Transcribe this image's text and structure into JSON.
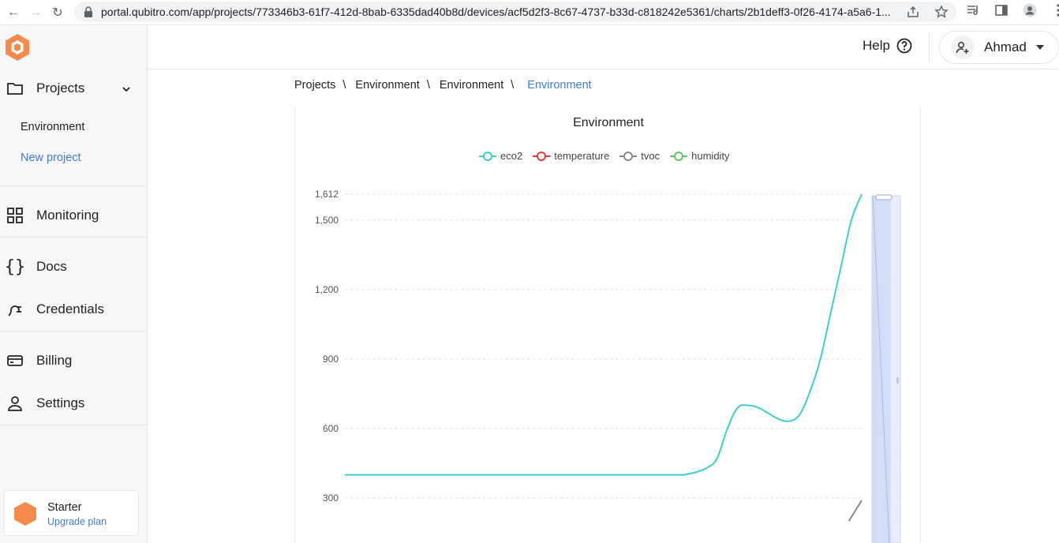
{
  "browser": {
    "url": "portal.qubitro.com/app/projects/773346b3-61f7-412d-8bab-6335dad40b8d/devices/acf5d2f3-8c67-4737-b33d-c818242e5361/charts/2b1deff3-0f26-4174-a5a6-1..."
  },
  "sidebar": {
    "projects_label": "Projects",
    "sub_items": [
      "Environment",
      "New project"
    ],
    "items": [
      "Monitoring",
      "Docs",
      "Credentials",
      "Billing",
      "Settings"
    ],
    "plan": {
      "name": "Starter",
      "upgrade": "Upgrade plan"
    }
  },
  "header": {
    "help": "Help",
    "user_name": "Ahmad"
  },
  "breadcrumb": [
    "Projects",
    "Environment",
    "Environment",
    "Environment"
  ],
  "breadcrumb_sep": "\\",
  "colors": {
    "accent": "#3d7be0",
    "brand": "#f58a4b",
    "eco2": "#3ccfc9",
    "temperature": "#e53935",
    "tvoc": "#888888",
    "humidity": "#5ac85a"
  },
  "chart_data": {
    "type": "line",
    "title": "Environment",
    "legend": [
      "eco2",
      "temperature",
      "tvoc",
      "humidity"
    ],
    "legend_position": "top-center",
    "yticks": [
      "1,612",
      "1,500",
      "1,200",
      "900",
      "600",
      "300"
    ],
    "ylim": [
      200,
      1612
    ],
    "grid": true,
    "series": [
      {
        "name": "eco2",
        "x": [
          0,
          5,
          10,
          15,
          20,
          25,
          30,
          35,
          40,
          45,
          50,
          55,
          60,
          65,
          66,
          68,
          70,
          72,
          74,
          76,
          78,
          80,
          82,
          84,
          86,
          88,
          90,
          92,
          94,
          96,
          98,
          100
        ],
        "values": [
          400,
          400,
          400,
          400,
          400,
          400,
          400,
          400,
          400,
          400,
          400,
          400,
          400,
          400,
          402,
          412,
          430,
          470,
          600,
          690,
          700,
          690,
          665,
          640,
          632,
          660,
          760,
          900,
          1100,
          1300,
          1500,
          1612
        ]
      },
      {
        "name": "tvoc",
        "x": [
          97.5,
          100
        ],
        "values": [
          200,
          290
        ]
      }
    ]
  }
}
